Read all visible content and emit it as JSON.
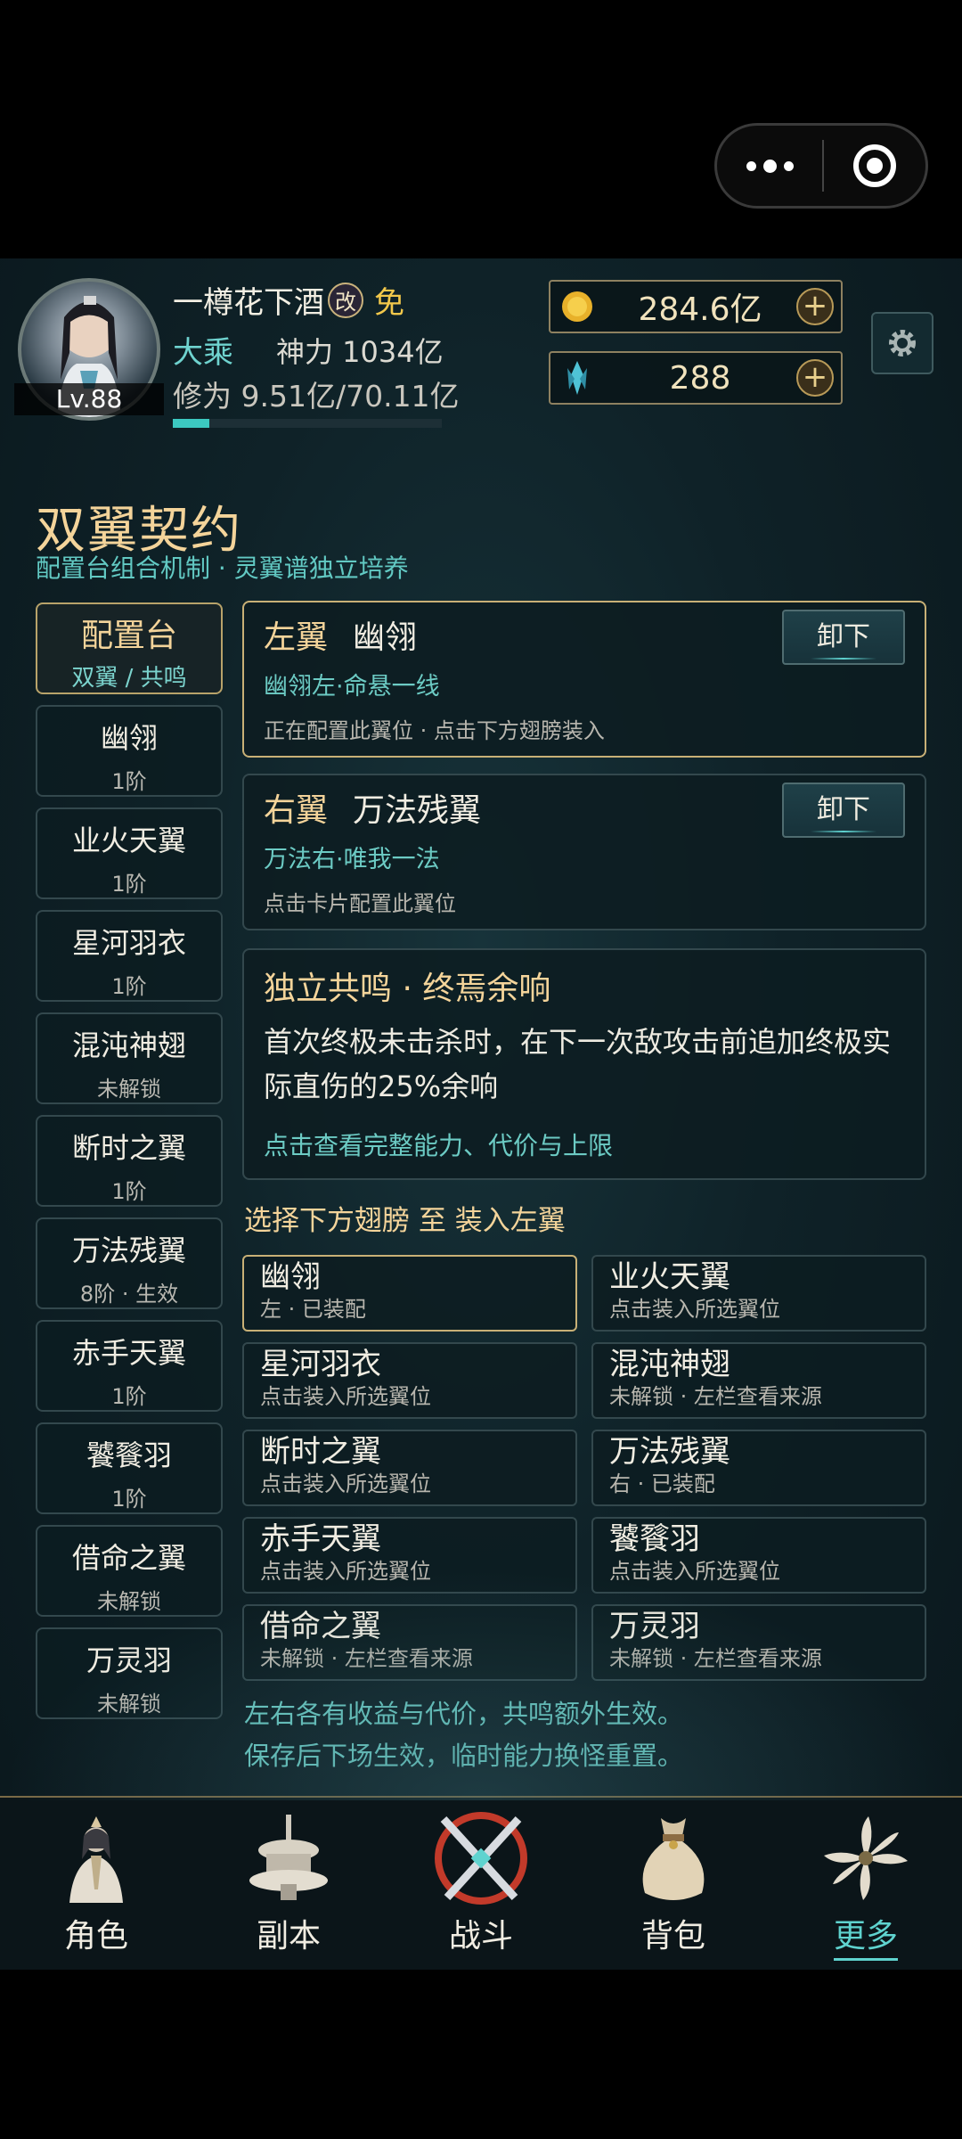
{
  "header": {
    "player_name": "一樽花下酒",
    "name_badge": "改",
    "name_tag": "免",
    "level": "Lv.88",
    "realm": "大乘",
    "power": "神力 1034亿",
    "cultivation": "修为 9.51亿/70.11亿",
    "cultivation_progress": 0.136,
    "gold": "284.6亿",
    "gems": "288"
  },
  "page": {
    "title": "双翼契约",
    "subtitle": "配置台组合机制 · 灵翼谱独立培养"
  },
  "sidebar": {
    "items": [
      {
        "name": "配置台",
        "sub": "双翼 / 共鸣"
      },
      {
        "name": "幽翎",
        "sub": "1阶"
      },
      {
        "name": "业火天翼",
        "sub": "1阶"
      },
      {
        "name": "星河羽衣",
        "sub": "1阶"
      },
      {
        "name": "混沌神翅",
        "sub": "未解锁"
      },
      {
        "name": "断时之翼",
        "sub": "1阶"
      },
      {
        "name": "万法残翼",
        "sub": "8阶 · 生效"
      },
      {
        "name": "赤手天翼",
        "sub": "1阶"
      },
      {
        "name": "饕餮羽",
        "sub": "1阶"
      },
      {
        "name": "借命之翼",
        "sub": "未解锁"
      },
      {
        "name": "万灵羽",
        "sub": "未解锁"
      }
    ]
  },
  "left_slot": {
    "label": "左翼",
    "wing": "幽翎",
    "sub": "幽翎左·命悬一线",
    "hint": "正在配置此翼位 · 点击下方翅膀装入",
    "button": "卸下"
  },
  "right_slot": {
    "label": "右翼",
    "wing": "万法残翼",
    "sub": "万法右·唯我一法",
    "hint": "点击卡片配置此翼位",
    "button": "卸下"
  },
  "resonance": {
    "title": "独立共鸣 · 终焉余响",
    "body": "首次终极未击杀时，在下一次敌攻击前追加终极实际直伤的25%余响",
    "link": "点击查看完整能力、代价与上限"
  },
  "choose_label": "选择下方翅膀 至 装入左翼",
  "wing_grid": [
    {
      "name": "幽翎",
      "status": "左 · 已装配"
    },
    {
      "name": "业火天翼",
      "status": "点击装入所选翼位"
    },
    {
      "name": "星河羽衣",
      "status": "点击装入所选翼位"
    },
    {
      "name": "混沌神翅",
      "status": "未解锁 · 左栏查看来源"
    },
    {
      "name": "断时之翼",
      "status": "点击装入所选翼位"
    },
    {
      "name": "万法残翼",
      "status": "右 · 已装配"
    },
    {
      "name": "赤手天翼",
      "status": "点击装入所选翼位"
    },
    {
      "name": "饕餮羽",
      "status": "点击装入所选翼位"
    },
    {
      "name": "借命之翼",
      "status": "未解锁 · 左栏查看来源"
    },
    {
      "name": "万灵羽",
      "status": "未解锁 · 左栏查看来源"
    }
  ],
  "notes": {
    "line1": "左右各有收益与代价，共鸣额外生效。",
    "line2": "保存后下场生效，临时能力换怪重置。"
  },
  "nav": {
    "items": [
      {
        "label": "角色",
        "icon": "character-icon"
      },
      {
        "label": "副本",
        "icon": "dungeon-icon"
      },
      {
        "label": "战斗",
        "icon": "battle-icon"
      },
      {
        "label": "背包",
        "icon": "bag-icon"
      },
      {
        "label": "更多",
        "icon": "more-icon"
      }
    ],
    "active": "更多"
  }
}
